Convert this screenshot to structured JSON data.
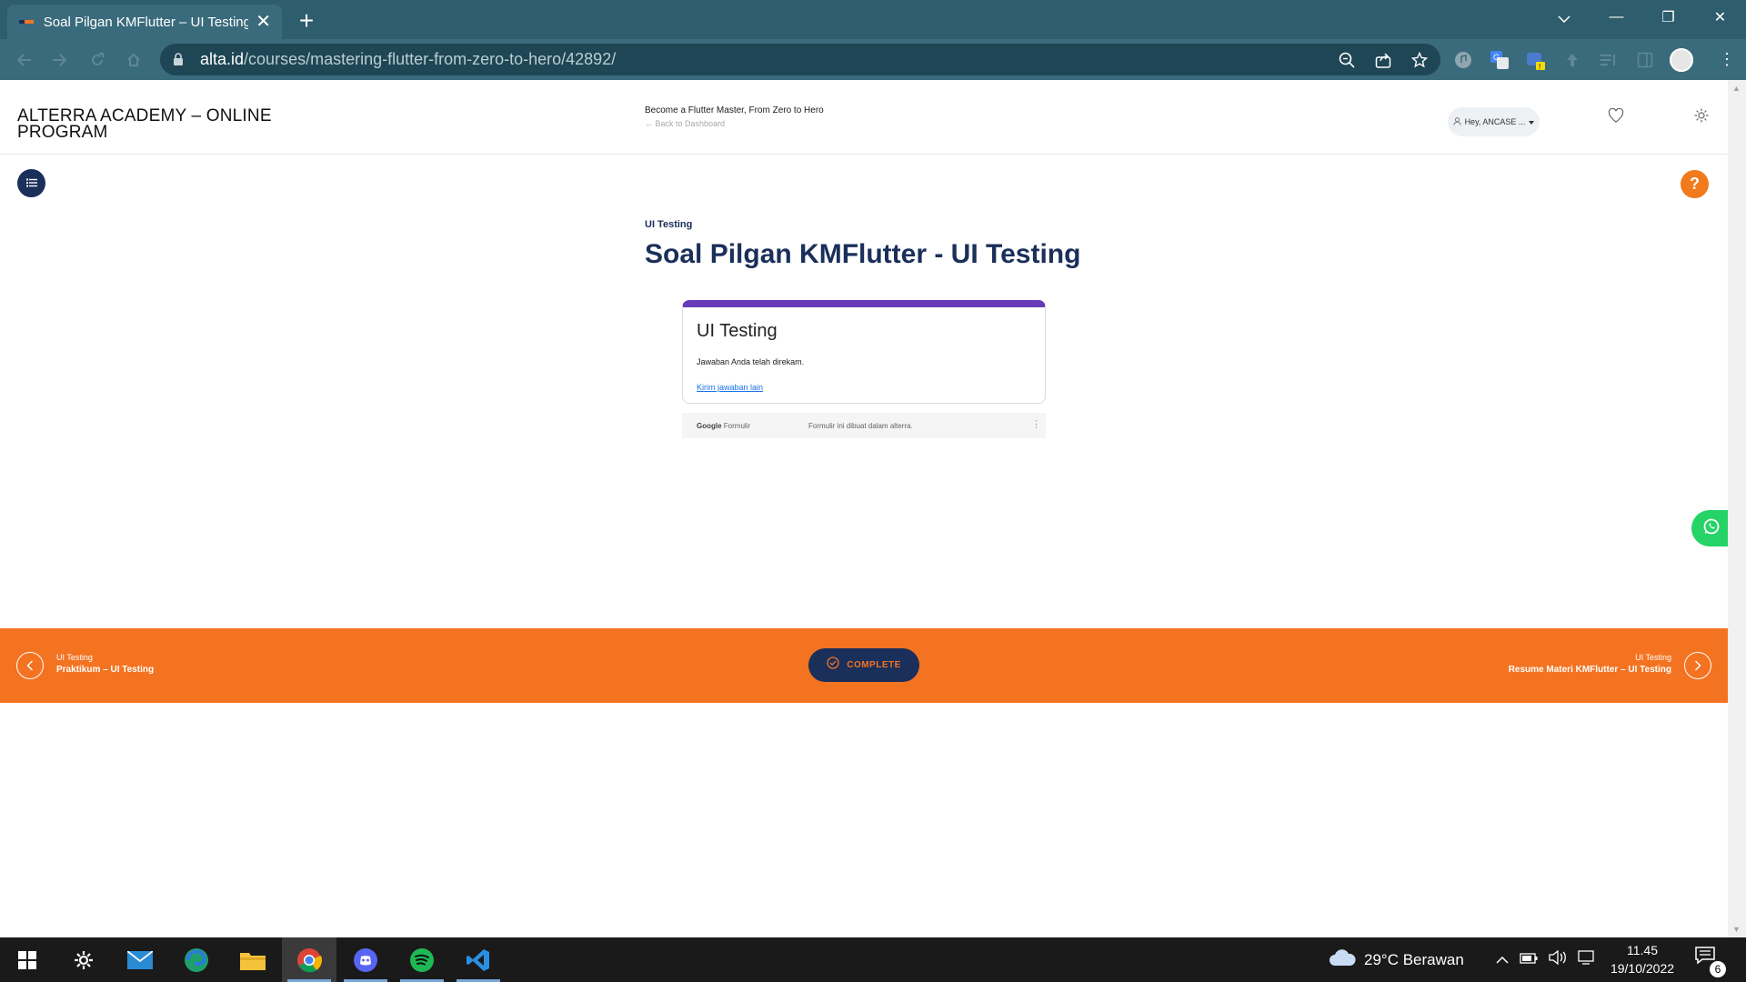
{
  "browser": {
    "tab_title": "Soal Pilgan KMFlutter – UI Testing",
    "tab_close": "✕",
    "new_tab": "+",
    "url_domain": "alta.id",
    "url_path": "/courses/mastering-flutter-from-zero-to-hero/42892/",
    "window_controls": {
      "minimize": "—",
      "maximize": "❐",
      "close": "✕"
    }
  },
  "header": {
    "brand": "ALTERRA ACADEMY – ONLINE PROGRAM",
    "course_title": "Become a Flutter Master, From Zero to Hero",
    "back_link": "← Back to Dashboard",
    "user_greeting": "Hey, ANCASE ..."
  },
  "lesson": {
    "section": "UI Testing",
    "title": "Soal Pilgan KMFlutter - UI Testing"
  },
  "form": {
    "title": "UI Testing",
    "message": "Jawaban Anda telah direkam.",
    "link": "Kirim jawaban lain",
    "footer_brand_a": "Google",
    "footer_brand_b": "Formulir",
    "footer_note": "Formulir ini dibuat dalam alterra."
  },
  "help": {
    "label": "?"
  },
  "navigation": {
    "prev_section": "UI Testing",
    "prev_title": "Praktikum – UI Testing",
    "complete_label": "COMPLETE",
    "next_section": "UI Testing",
    "next_title": "Resume Materi KMFlutter – UI Testing"
  },
  "taskbar": {
    "weather": "29°C  Berawan",
    "time": "11.45",
    "date": "19/10/2022",
    "notifications": "6"
  },
  "colors": {
    "accent_orange": "#f37321",
    "navy": "#1a2f5a",
    "form_purple": "#673ab7",
    "browser_teal": "#3a6b7c"
  }
}
